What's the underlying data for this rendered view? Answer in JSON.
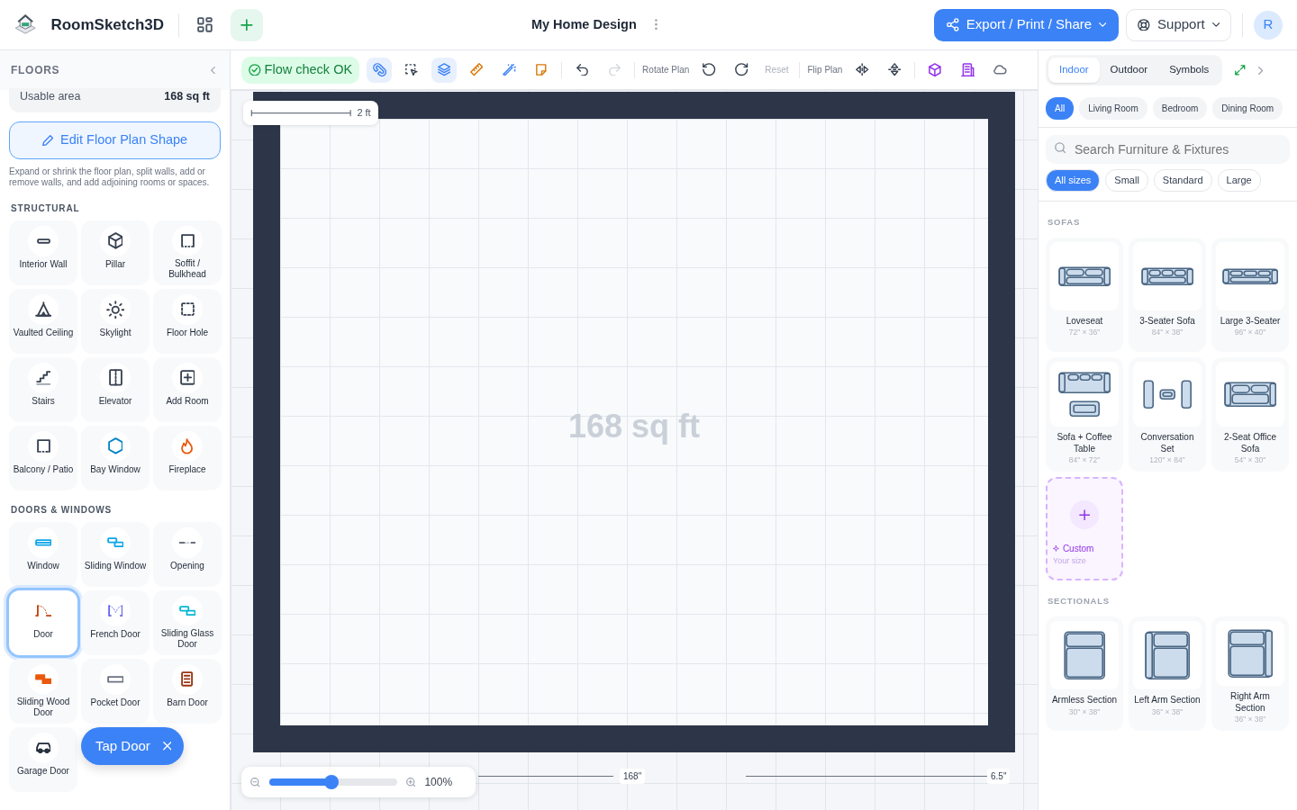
{
  "header": {
    "app_name": "RoomSketch3D",
    "project_title": "My Home Design",
    "export_button": "Export / Print / Share",
    "support_button": "Support",
    "avatar_initial": "R"
  },
  "toolbar": {
    "flow_check": "Flow check OK",
    "tools": [
      {
        "active": true
      },
      {
        "active": false
      },
      {
        "active": true
      },
      {
        "active": false
      },
      {
        "active": false
      },
      {
        "active": false
      }
    ],
    "history": [
      {
        "disabled": false
      },
      {
        "disabled": true
      }
    ],
    "rotate_label": "Rotate Plan",
    "reset": {
      "label": "Reset",
      "disabled": true
    },
    "flip_label": "Flip Plan"
  },
  "sidebar": {
    "title": "FLOORS",
    "usable_area": {
      "label": "Usable area",
      "value": "168 sq ft"
    },
    "edit_button": "Edit Floor Plan Shape",
    "description": "Expand or shrink the floor plan, split walls, add or remove walls, and add adjoining rooms or spaces.",
    "sections": [
      {
        "title": "STRUCTURAL",
        "items": [
          {
            "label": "Interior Wall",
            "selected": false
          },
          {
            "label": "Pillar",
            "selected": false
          },
          {
            "label": "Soffit / Bulkhead",
            "selected": false
          },
          {
            "label": "Vaulted Ceiling",
            "selected": false
          },
          {
            "label": "Skylight",
            "selected": false
          },
          {
            "label": "Floor Hole",
            "selected": false
          },
          {
            "label": "Stairs",
            "selected": false
          },
          {
            "label": "Elevator",
            "selected": false
          },
          {
            "label": "Add Room",
            "selected": false
          },
          {
            "label": "Balcony / Patio",
            "selected": false
          },
          {
            "label": "Bay Window",
            "selected": false
          },
          {
            "label": "Fireplace",
            "selected": false
          }
        ]
      },
      {
        "title": "DOORS & WINDOWS",
        "items": [
          {
            "label": "Window",
            "selected": false
          },
          {
            "label": "Sliding Window",
            "selected": false
          },
          {
            "label": "Opening",
            "selected": false
          },
          {
            "label": "Door",
            "selected": true
          },
          {
            "label": "French Door",
            "selected": false
          },
          {
            "label": "Sliding Glass Door",
            "selected": false
          },
          {
            "label": "Sliding Wood Door",
            "selected": false
          },
          {
            "label": "Pocket Door",
            "selected": false
          },
          {
            "label": "Barn Door",
            "selected": false
          },
          {
            "label": "Garage Door",
            "selected": false
          }
        ]
      }
    ]
  },
  "toast": {
    "label": "Tap Door"
  },
  "canvas": {
    "scale_label": "2 ft",
    "area_label": "168 sq ft",
    "width_dimension": "168\"",
    "wall_dimension": "6.5\"",
    "zoom": {
      "level": 0.49,
      "reading": "100%"
    }
  },
  "library": {
    "tabs": [
      {
        "label": "Indoor",
        "selected": true
      },
      {
        "label": "Outdoor",
        "selected": false
      },
      {
        "label": "Symbols",
        "selected": false
      }
    ],
    "rooms": [
      {
        "label": "All",
        "selected": true
      },
      {
        "label": "Living Room",
        "selected": false
      },
      {
        "label": "Bedroom",
        "selected": false
      },
      {
        "label": "Dining Room",
        "selected": false
      }
    ],
    "search": {
      "placeholder": "Search Furniture & Fixtures"
    },
    "sizes": [
      {
        "label": "All sizes",
        "selected": true
      },
      {
        "label": "Small",
        "selected": false
      },
      {
        "label": "Standard",
        "selected": false
      },
      {
        "label": "Large",
        "selected": false
      }
    ],
    "sections": [
      {
        "title": "SOFAS",
        "items": [
          {
            "name": "Loveseat",
            "size": "72\" × 36\""
          },
          {
            "name": "3-Seater Sofa",
            "size": "84\" × 38\""
          },
          {
            "name": "Large 3-Seater",
            "size": "96\" × 40\""
          },
          {
            "name": "Sofa + Coffee Table",
            "size": "84\" × 72\""
          },
          {
            "name": "Conversation Set",
            "size": "120\" × 84\""
          },
          {
            "name": "2-Seat Office Sofa",
            "size": "54\" × 30\""
          }
        ],
        "custom": {
          "label": "Custom",
          "sub": "Your size"
        }
      },
      {
        "title": "SECTIONALS",
        "items": [
          {
            "name": "Armless Section",
            "size": "30\" × 38\""
          },
          {
            "name": "Left Arm Section",
            "size": "36\" × 38\""
          },
          {
            "name": "Right Arm Section",
            "size": "36\" × 38\""
          }
        ]
      }
    ]
  }
}
